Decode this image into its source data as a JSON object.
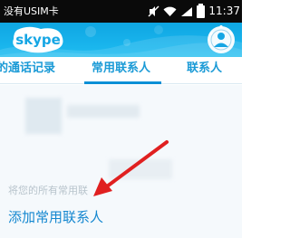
{
  "status_bar": {
    "carrier": "没有USIM卡",
    "time": "11:37"
  },
  "header": {
    "logo_text": "skype",
    "brand_color": "#19b0ec"
  },
  "tabs": [
    {
      "label": "的通话记录",
      "active": false
    },
    {
      "label": "常用联系人",
      "active": true
    },
    {
      "label": "联系人",
      "active": false
    }
  ],
  "main": {
    "hint": "将您的所有常用联",
    "add_favorite_label": "添加常用联系人"
  },
  "icons": [
    "mute-icon",
    "wifi-icon",
    "signal-icon",
    "battery-icon",
    "presence-icon"
  ],
  "colors": {
    "accent": "#1688d0",
    "tab_text": "#1a9ad6",
    "annotation_arrow": "#e02020"
  }
}
